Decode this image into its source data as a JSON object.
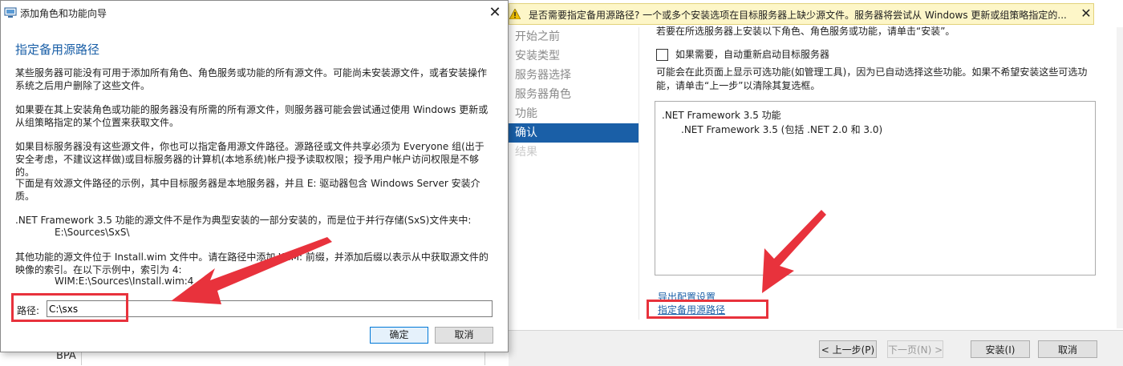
{
  "background_window": {
    "warning_bar": {
      "icon": "warning-icon",
      "text": "是否需要指定备用源路径? 一个或多个安装选项在目标服务器上缺少源文件。服务器将尝试从 Windows 更新或组策略指定的...",
      "close_label": "✕"
    },
    "nav_items": [
      {
        "label": "开始之前",
        "state": "normal"
      },
      {
        "label": "安装类型",
        "state": "normal"
      },
      {
        "label": "服务器选择",
        "state": "normal"
      },
      {
        "label": "服务器角色",
        "state": "normal"
      },
      {
        "label": "功能",
        "state": "normal"
      },
      {
        "label": "确认",
        "state": "active"
      },
      {
        "label": "结果",
        "state": "disabled"
      }
    ],
    "top_instruction": "若要在所选服务器上安装以下角色、角色服务或功能，请单击“安装”。",
    "restart_checkbox_label": "如果需要，自动重新启动目标服务器",
    "optional_note": "可能会在此页面上显示可选功能(如管理工具)，因为已自动选择这些功能。如果不希望安装这些可选功能，请单击“上一步”以清除其复选框。",
    "features": {
      "item1": ".NET Framework 3.5 功能",
      "item2": ".NET Framework 3.5 (包括 .NET 2.0 和 3.0)"
    },
    "export_link": "导出配置设置",
    "alt_source_link": "指定备用源路径",
    "buttons": {
      "prev": "< 上一步(P)",
      "next": "下一页(N) >",
      "install": "安装(I)",
      "cancel": "取消"
    }
  },
  "dialog": {
    "title": "添加角色和功能向导",
    "close_label": "✕",
    "heading": "指定备用源路径",
    "para1": "某些服务器可能没有可用于添加所有角色、角色服务或功能的所有源文件。可能尚未安装源文件，或者安装操作系统之后用户删除了这些文件。",
    "para2": "如果要在其上安装角色或功能的服务器没有所需的所有源文件，则服务器可能会尝试通过使用 Windows 更新或从组策略指定的某个位置来获取文件。",
    "para3": "如果目标服务器没有这些源文件，你也可以指定备用源文件路径。源路径或文件共享必须为 Everyone 组(出于安全考虑，不建议这样做)或目标服务器的计算机(本地系统)帐户授予读取权限；授予用户帐户访问权限是不够的。",
    "para4": "下面是有效源文件路径的示例，其中目标服务器是本地服务器，并且 E: 驱动器包含 Windows Server 安装介质。",
    "para5": ".NET Framework 3.5 功能的源文件不是作为典型安装的一部分安装的，而是位于并行存储(SxS)文件夹中:",
    "example1": "E:\\Sources\\SxS\\",
    "para6": "其他功能的源文件位于 Install.wim 文件中。请在路径中添加 WIM: 前缀，并添加后缀以表示从中获取源文件的映像的索引。在以下示例中，索引为 4:",
    "example2": "WIM:E:\\Sources\\Install.wim:4",
    "path_label": "路径:",
    "path_value": "C:\\sxs",
    "ok_label": "确定",
    "cancel_label": "取消"
  },
  "background_fragment": {
    "bpa_label": "BPA"
  },
  "colors": {
    "accent": "#1a5fa7",
    "annotation_red": "#e8323c",
    "warning_bg": "#fdf6c8"
  }
}
